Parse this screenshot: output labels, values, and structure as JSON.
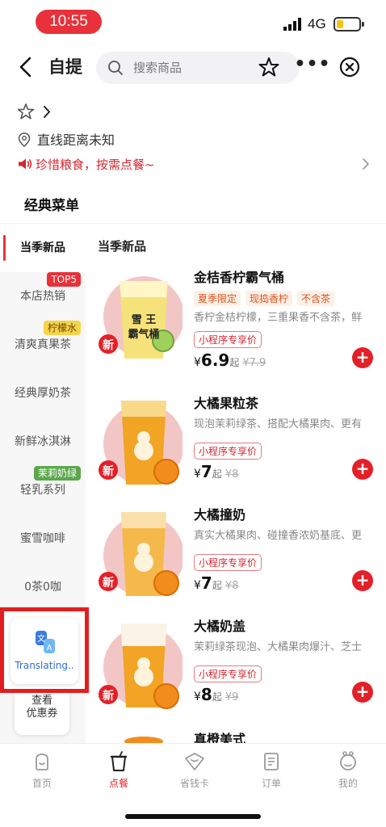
{
  "status_bar": {
    "time": "10:55",
    "network": "4G",
    "time_color": "#e8313a"
  },
  "nav": {
    "title": "自提",
    "search_placeholder": "搜索商品"
  },
  "store": {
    "distance": "直线距离未知",
    "notice": "珍惜粮食，按需点餐~"
  },
  "menu_tab": "经典菜单",
  "sidebar": {
    "items": [
      {
        "label": "当季新品"
      },
      {
        "label": "本店热销",
        "badge": "TOP5"
      },
      {
        "label": "清爽真果茶",
        "badge": "柠檬水"
      },
      {
        "label": "经典厚奶茶"
      },
      {
        "label": "新鲜冰淇淋"
      },
      {
        "label": "轻乳系列",
        "badge": "茉莉奶绿"
      },
      {
        "label": "蜜雪咖啡"
      },
      {
        "label": "0茶0咖"
      }
    ],
    "translating_label": "Translating..",
    "coupon_label_1": "查看",
    "coupon_label_2": "优惠券"
  },
  "section_title": "当季新品",
  "products": [
    {
      "name": "金桔香柠霸气桶",
      "tags": [
        "夏季限定",
        "现捣香柠",
        "不含茶"
      ],
      "desc": "香柠金桔柠檬，三重果香不含茶，鲜",
      "mini_price_label": "小程序专享价",
      "yen": "¥",
      "price": "6.9",
      "qi": "起",
      "old_price": "¥7.9",
      "new_badge": "新",
      "cup_text_1": "雪 王",
      "cup_text_2": "霸气桶"
    },
    {
      "name": "大橘果粒茶",
      "desc": "现泡茉莉绿茶、搭配大橘果肉、更有",
      "mini_price_label": "小程序专享价",
      "yen": "¥",
      "price": "7",
      "qi": "起",
      "old_price": "¥8",
      "new_badge": "新"
    },
    {
      "name": "大橘撞奶",
      "desc": "真实大橘果肉、碰撞香浓奶基底、更",
      "mini_price_label": "小程序专享价",
      "yen": "¥",
      "price": "7",
      "qi": "起",
      "old_price": "¥8",
      "new_badge": "新"
    },
    {
      "name": "大橘奶盖",
      "desc": "茉莉绿茶现泡、大橘果肉爆汁、芝士",
      "mini_price_label": "小程序专享价",
      "yen": "¥",
      "price": "8",
      "qi": "起",
      "old_price": "¥9",
      "new_badge": "新"
    },
    {
      "name": "真橙美式"
    }
  ],
  "tabbar": [
    {
      "label": "首页",
      "icon": "home-icon"
    },
    {
      "label": "点餐",
      "icon": "cup-icon",
      "active": true
    },
    {
      "label": "省钱卡",
      "icon": "savings-card-icon"
    },
    {
      "label": "订单",
      "icon": "order-icon"
    },
    {
      "label": "我的",
      "icon": "profile-icon"
    }
  ],
  "colors": {
    "brand_red": "#e32028",
    "tag_orange": "#d9531e"
  }
}
